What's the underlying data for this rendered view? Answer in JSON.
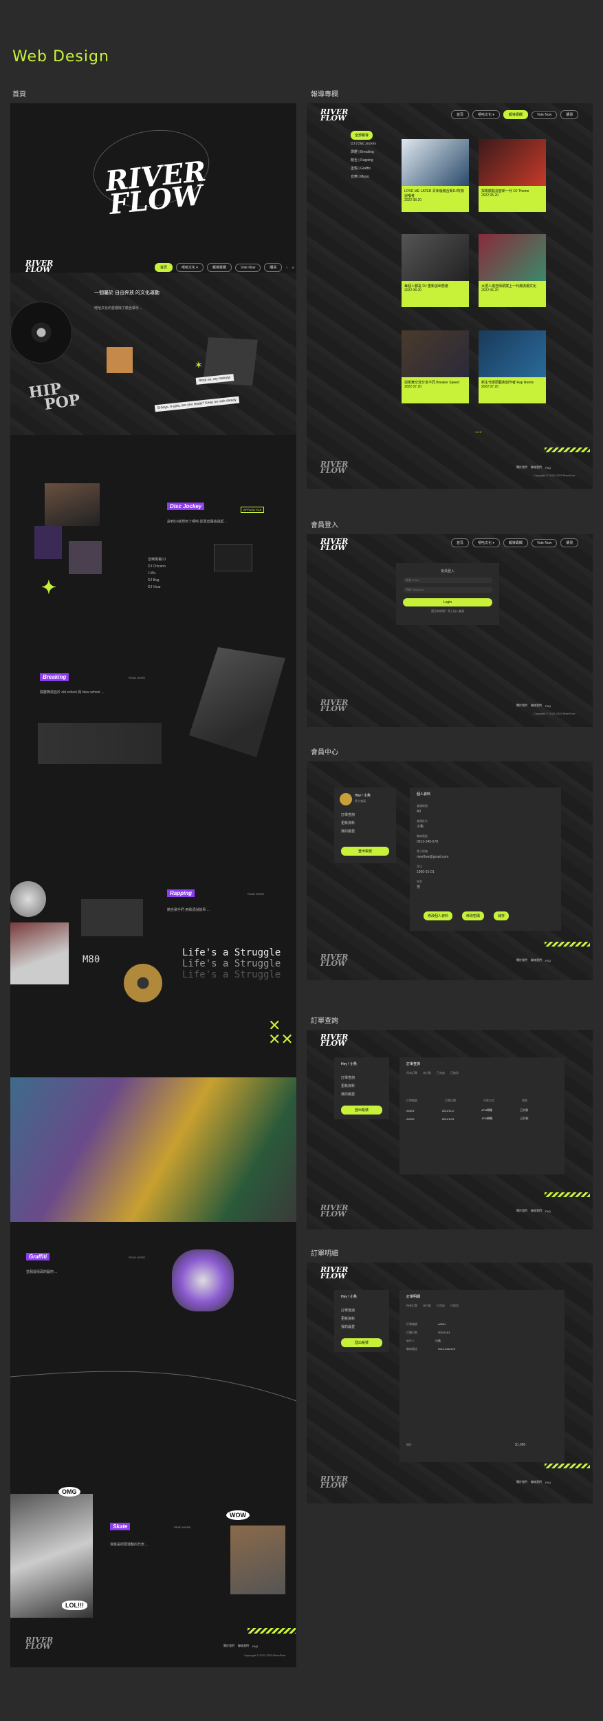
{
  "title": "Web Design",
  "sections": {
    "home": "首頁",
    "report": "報導專欄",
    "login": "會員登入",
    "member": "會員中心",
    "order_query": "訂單查詢",
    "order_detail": "訂單明細"
  },
  "logo": {
    "line1": "RIVER",
    "line2": "FLOW"
  },
  "nav": {
    "items": [
      "首頁",
      "嘻哈文化 ▾",
      "報導專欄",
      "Vote Now",
      "購買"
    ],
    "report_items": [
      "首頁",
      "嘻哈文化 ▾",
      "報導專欄",
      "Vote Now",
      "購買"
    ]
  },
  "home": {
    "hero_text": "一個屬於 自由奔放 的文化運動",
    "hero_tag1": "自由奔放",
    "hero_body": "嘻哈文化的發展除了饒舌歌手...",
    "hip": "HIP",
    "pop": "POP",
    "quote": "B-boys, b-girls, are you ready? Keep on rock steady",
    "sticker": "Rock on, my melody!",
    "dj": {
      "tag": "Disc Jockey",
      "sub": "DJ",
      "label": "APPLIED FILE",
      "names": [
        "DJ Chicano",
        "J.Wu",
        "DJ Bug",
        "DJ Vicar"
      ],
      "caption": "音樂風格DJ"
    },
    "breaking": {
      "tag": "Breaking",
      "sub": "霹靂舞",
      "more": "READ MORE"
    },
    "rapping": {
      "tag": "Rapping",
      "sub": "饒舌",
      "more": "READ MORE",
      "m80": "M80",
      "struggle": [
        "Life's a Struggle",
        "Life's a Struggle",
        "Life's a Struggle"
      ]
    },
    "graffiti": {
      "tag": "Graffiti",
      "sub": "塗鴉",
      "more": "READ MORE"
    },
    "skate": {
      "tag": "Skate",
      "sub": "滑板",
      "more": "READ MORE",
      "omg": "OMG",
      "wow": "WOW",
      "lol": "LOL!!!"
    },
    "footer": [
      "關於我們",
      "聯絡我們",
      "FAQ"
    ],
    "copyright": "Copyright © 2022-2023 RiverFlow"
  },
  "report": {
    "all_tag": "全部報導",
    "menu": [
      "DJ | Disc Jockey",
      "霹靂 | Breaking",
      "饒舌 | Rapping",
      "塗鴉 | Graffiti",
      "音樂 | Music"
    ],
    "cards": [
      {
        "date": "2022 08.20",
        "title": "LOVE ME LATER 青年版饒舌新DJ吹狗說唱者"
      },
      {
        "date": "2022 05.20",
        "title": "捍衛觀點混音新一代 DJ Theme"
      },
      {
        "date": "2022 08.20",
        "title": "每個人都是 DJ 重新說出態度"
      },
      {
        "date": "2022 06.20",
        "title": "大把人進自街頭撲上一代潮流潮文化"
      },
      {
        "date": "2022 07.20",
        "title": "與街舞交流分享不同 Breaker Speed"
      },
      {
        "date": "2022 07.20",
        "title": "新生代街頭藝術創作者 Rap Remix"
      }
    ],
    "pager": "1 2 3"
  },
  "login": {
    "title": "會員登入",
    "email": "帳號 Email",
    "password": "密碼 Password",
    "button": "Login",
    "link": "還沒有帳號？馬上加入會員"
  },
  "member": {
    "name": "Hey ! 小魚",
    "level": "黑卡會員",
    "menu": [
      "訂單查詢",
      "更新資料",
      "我的最愛"
    ],
    "logout": "登出帳號",
    "info_title": "個人資料",
    "fields": [
      {
        "k": "會員帳號",
        "v": "A0"
      },
      {
        "k": "會員姓名",
        "v": "小魚"
      },
      {
        "k": "聯絡電話",
        "v": "0912-345-678"
      },
      {
        "k": "電子信箱",
        "v": "riverflow@gmail.com"
      },
      {
        "k": "生日",
        "v": "1990-01-01"
      },
      {
        "k": "性別",
        "v": "男"
      }
    ],
    "btns": [
      "修改個人資料",
      "修改密碼",
      "儲存"
    ]
  },
  "order": {
    "title": "訂單查詢",
    "tabs": [
      "所有訂單",
      "未付款",
      "已完成",
      "已取消"
    ],
    "cols": [
      "訂單編號",
      "訂單日期",
      "付款方式",
      "狀態"
    ],
    "rows": [
      [
        "A0001",
        "2021/11/1",
        "ATM轉帳",
        "已付款"
      ],
      [
        "A0002",
        "2021/12/3",
        "ATM轉帳",
        "已付款"
      ]
    ]
  },
  "detail": {
    "title": "訂單明細",
    "tabs": [
      "所有訂單",
      "未付款",
      "已完成",
      "已取消"
    ],
    "items": [
      {
        "k": "訂單編號",
        "v": "A0001"
      },
      {
        "k": "訂購日期",
        "v": "2021/11/1"
      },
      {
        "k": "收件人",
        "v": "小魚"
      },
      {
        "k": "聯絡電話",
        "v": "0912-345-678"
      }
    ],
    "total_label": "總計",
    "total": "$1,980"
  }
}
